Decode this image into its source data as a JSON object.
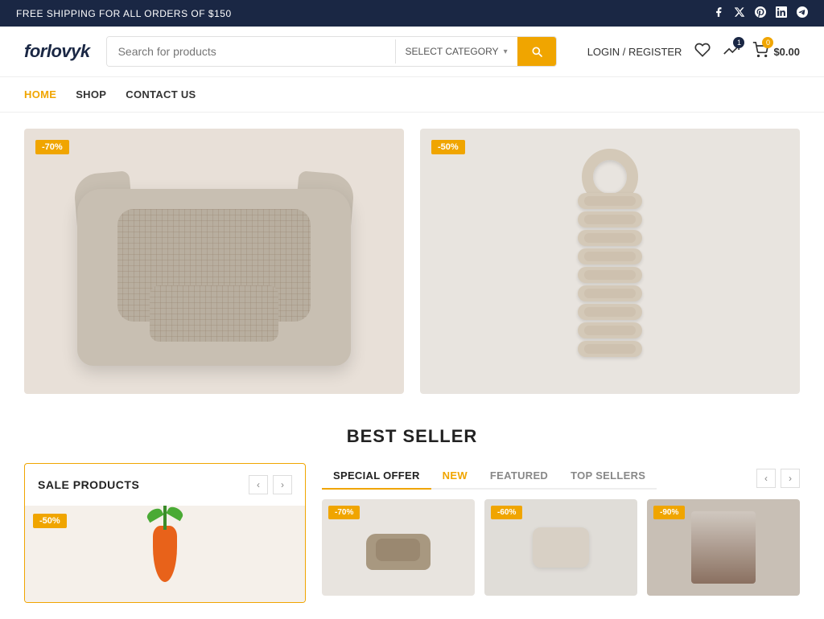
{
  "topBanner": {
    "text": "FREE SHIPPING FOR ALL ORDERS OF $150",
    "socialIcons": [
      "facebook",
      "x-twitter",
      "pinterest",
      "linkedin",
      "telegram"
    ]
  },
  "header": {
    "logo": "forlovyk",
    "search": {
      "placeholder": "Search for products",
      "categoryLabel": "SELECT CATEGORY",
      "buttonLabel": "Search"
    },
    "actions": {
      "loginRegister": "LOGIN / REGISTER",
      "wishlistCount": "",
      "compareCount": "1",
      "cartCount": "0",
      "cartPrice": "$0.00"
    }
  },
  "nav": {
    "items": [
      {
        "label": "HOME",
        "active": true
      },
      {
        "label": "SHOP",
        "active": false
      },
      {
        "label": "CONTACT US",
        "active": false
      }
    ]
  },
  "hero": {
    "left": {
      "badge": "-70%",
      "alt": "Pet bed"
    },
    "right": {
      "badge": "-50%",
      "alt": "Rope toy"
    }
  },
  "bestSeller": {
    "title": "BEST SELLER"
  },
  "saleProducts": {
    "title": "SALE PRODUCTS",
    "badge": "-50%"
  },
  "specialOffer": {
    "tabs": [
      {
        "label": "SPECIAL OFFER",
        "active": true
      },
      {
        "label": "NEW",
        "highlight": true
      },
      {
        "label": "FEATURED",
        "active": false
      },
      {
        "label": "TOP SELLERS",
        "active": false
      }
    ],
    "products": [
      {
        "badge": "-70%"
      },
      {
        "badge": "-60%"
      },
      {
        "badge": "-90%"
      }
    ]
  }
}
